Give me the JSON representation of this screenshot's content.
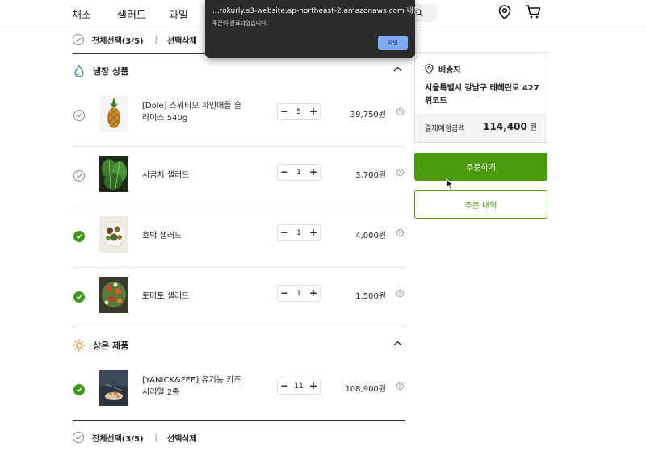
{
  "nav": {
    "items": [
      "채소",
      "샐러드",
      "과일"
    ],
    "search_icon": "search-icon",
    "location_icon": "location-pin-icon",
    "cart_icon": "cart-icon"
  },
  "alert": {
    "title": "...rokurly.s3-website.ap-northeast-2.amazonaws.com 내용:",
    "message": "주문이 완료되었습니다.",
    "ok_label": "확인"
  },
  "select_bar": {
    "select_all_label": "전체선택(3/5)",
    "separator": "|",
    "delete_selected_label": "선택삭제"
  },
  "sections": [
    {
      "title": "냉장 상품",
      "icon": "water-drop-icon",
      "items": [
        {
          "name": "[Dole] 스위티오 파인애플 슬라이스 540g",
          "qty": "5",
          "price": "39,750원",
          "checked": false
        },
        {
          "name": "시금치 샐러드",
          "qty": "1",
          "price": "3,700원",
          "checked": false
        },
        {
          "name": "호박 샐러드",
          "qty": "1",
          "price": "4,000원",
          "checked": true
        },
        {
          "name": "토마토 샐러드",
          "qty": "1",
          "price": "1,500원",
          "checked": true
        }
      ]
    },
    {
      "title": "상온 제품",
      "icon": "sun-icon",
      "items": [
        {
          "name": "[YANICK&FEE] 유기농 키즈 시리얼 2종",
          "qty": "11",
          "price": "108,900원",
          "checked": true
        }
      ]
    }
  ],
  "stepper": {
    "minus": "−",
    "plus": "+"
  },
  "delivery": {
    "title": "배송지",
    "address": "서울특별시 강남구 테헤란로 427 위코드",
    "total_label": "결제예정금액",
    "total_value": "114,400",
    "total_unit": "원"
  },
  "buttons": {
    "order": "주문하기",
    "history": "주문 내역"
  },
  "colors": {
    "accent": "#4a9a0f",
    "check_on": "#3f9a17"
  }
}
